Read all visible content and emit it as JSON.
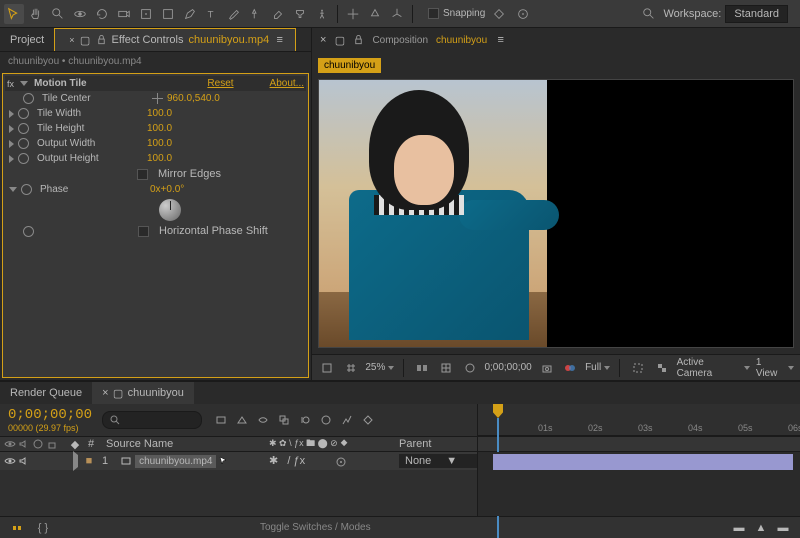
{
  "toolbar": {
    "snapping": "Snapping",
    "workspace_label": "Workspace:",
    "workspace_value": "Standard"
  },
  "left_panel": {
    "tab_project": "Project",
    "tab_effect": "Effect Controls",
    "tab_effect_file": "chuunibyou.mp4",
    "breadcrumb": "chuunibyou • chuunibyou.mp4",
    "fx_name": "Motion Tile",
    "fx_reset": "Reset",
    "fx_about": "About...",
    "props": {
      "tile_center": {
        "label": "Tile Center",
        "value": "960.0,540.0"
      },
      "tile_width": {
        "label": "Tile Width",
        "value": "100.0"
      },
      "tile_height": {
        "label": "Tile Height",
        "value": "100.0"
      },
      "output_width": {
        "label": "Output Width",
        "value": "100.0"
      },
      "output_height": {
        "label": "Output Height",
        "value": "100.0"
      },
      "mirror_edges": {
        "label": "Mirror Edges"
      },
      "phase": {
        "label": "Phase",
        "value": "0x+0.0°"
      },
      "horizontal_shift": {
        "label": "Horizontal Phase Shift"
      }
    }
  },
  "comp": {
    "tab_label": "Composition",
    "tab_file": "chuunibyou",
    "label": "chuunibyou"
  },
  "viewer": {
    "zoom": "25%",
    "timecode": "0;00;00;00",
    "resolution": "Full",
    "camera": "Active Camera",
    "views": "1 View"
  },
  "timeline": {
    "tab_rq": "Render Queue",
    "tab_comp": "chuunibyou",
    "timecode": "0;00;00;00",
    "fps": "00000 (29.97 fps)",
    "col_num": "#",
    "col_source": "Source Name",
    "col_parent": "Parent",
    "layer": {
      "num": "1",
      "name": "chuunibyou.mp4",
      "parent": "None"
    },
    "marks": [
      "01s",
      "02s",
      "03s",
      "04s",
      "05s",
      "06s"
    ]
  },
  "bottom": {
    "toggle": "Toggle Switches / Modes"
  }
}
